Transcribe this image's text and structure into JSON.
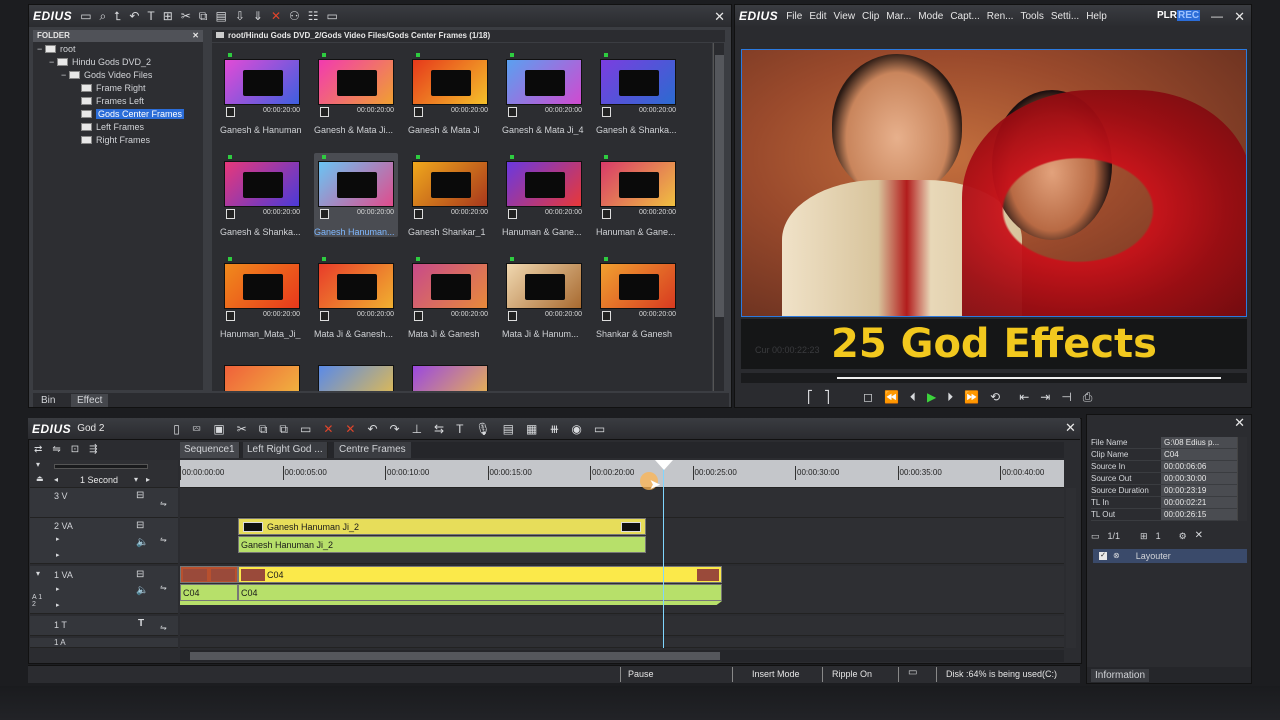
{
  "bin_window": {
    "brand": "EDIUS",
    "folder_header": "FOLDER",
    "path": "root/Hindu Gods DVD_2/Gods Video Files/Gods Center Frames (1/18)",
    "tree": [
      {
        "label": "root",
        "indent": 0
      },
      {
        "label": "Hindu Gods DVD_2",
        "indent": 1
      },
      {
        "label": "Gods Video Files",
        "indent": 2
      },
      {
        "label": "Frame Right",
        "indent": 3
      },
      {
        "label": "Frames Left",
        "indent": 3
      },
      {
        "label": "Gods Center Frames",
        "indent": 3,
        "selected": true
      },
      {
        "label": "Left Frames",
        "indent": 3
      },
      {
        "label": "Right Frames",
        "indent": 3
      }
    ],
    "thumbs": [
      {
        "name": "Ganesh & Hanuman",
        "dur": "00:00:20:00",
        "c1": "#e24bd6",
        "c2": "#3d5fe0"
      },
      {
        "name": "Ganesh & Mata Ji...",
        "dur": "00:00:20:00",
        "c1": "#f23ab0",
        "c2": "#f0a030"
      },
      {
        "name": "Ganesh & Mata Ji",
        "dur": "00:00:20:00",
        "c1": "#e6391b",
        "c2": "#f5c02a"
      },
      {
        "name": "Ganesh & Mata Ji_4",
        "dur": "00:00:20:00",
        "c1": "#5aa0f0",
        "c2": "#d04ad0"
      },
      {
        "name": "Ganesh & Shanka...",
        "dur": "00:00:20:00",
        "c1": "#7b3de0",
        "c2": "#2b6bd0"
      },
      {
        "name": "Ganesh & Shanka...",
        "dur": "00:00:20:00",
        "c1": "#e8387a",
        "c2": "#4a3ad8"
      },
      {
        "name": "Ganesh Hanuman...",
        "dur": "00:00:20:00",
        "c1": "#6ac4f4",
        "c2": "#e04c8c",
        "selected": true
      },
      {
        "name": "Ganesh Shankar_1",
        "dur": "00:00:20:00",
        "c1": "#f0a81c",
        "c2": "#a8381c"
      },
      {
        "name": "Hanuman & Gane...",
        "dur": "00:00:20:00",
        "c1": "#6a38e0",
        "c2": "#e83838"
      },
      {
        "name": "Hanuman & Gane...",
        "dur": "00:00:20:00",
        "c1": "#d83a6a",
        "c2": "#f0c040"
      },
      {
        "name": "Hanuman_Mata_Ji_",
        "dur": "00:00:20:00",
        "c1": "#f08a1c",
        "c2": "#e8381c"
      },
      {
        "name": "Mata Ji & Ganesh...",
        "dur": "00:00:20:00",
        "c1": "#e83c2a",
        "c2": "#f0b030"
      },
      {
        "name": "Mata Ji & Ganesh",
        "dur": "00:00:20:00",
        "c1": "#c84a8a",
        "c2": "#e88a3a"
      },
      {
        "name": "Mata Ji & Hanum...",
        "dur": "00:00:20:00",
        "c1": "#f0d8b0",
        "c2": "#a86a30"
      },
      {
        "name": "Shankar & Ganesh",
        "dur": "00:00:20:00",
        "c1": "#f0a030",
        "c2": "#d83a20"
      }
    ],
    "tabs": [
      "Bin",
      "Effect"
    ]
  },
  "player": {
    "brand": "EDIUS",
    "menu": [
      "File",
      "Edit",
      "View",
      "Clip",
      "Mar...",
      "Mode",
      "Capt...",
      "Ren...",
      "Tools",
      "Setti...",
      "Help"
    ],
    "mode_plr": "PLR",
    "mode_rec": "REC",
    "overlay_text": "25 God Effects",
    "overlay_color": "#f2c81e",
    "ghost_tc": "Cur 00:00:22:23"
  },
  "timeline": {
    "brand": "EDIUS",
    "project": "God 2",
    "seq_tabs": [
      "Sequence1",
      "Left Right God ...",
      "Centre Frames"
    ],
    "scale": "1 Second",
    "ruler": [
      "00:00:00:00",
      "00:00:05:00",
      "00:00:10:00",
      "00:00:15:00",
      "00:00:20:00",
      "00:00:25:00",
      "00:00:30:00",
      "00:00:35:00",
      "00:00:40:00"
    ],
    "tracks": {
      "t3v": "3 V",
      "t2va": "2 VA",
      "t1va": "1 VA",
      "t1t": "1 T",
      "t1a": "1 A",
      "a12": "A 1 2"
    },
    "clips": {
      "v2_video": "Ganesh Hanuman Ji_2",
      "v2_audio": "Ganesh Hanuman Ji_2",
      "v1_video": "C04",
      "v1_audio_a": "C04",
      "v1_audio_b": "C04"
    }
  },
  "info": {
    "rows": [
      {
        "k": "File Name",
        "v": "G:\\08 Edius p..."
      },
      {
        "k": "Clip Name",
        "v": "C04"
      },
      {
        "k": "Source In",
        "v": "00:00:06:06"
      },
      {
        "k": "Source Out",
        "v": "00:00:30:00"
      },
      {
        "k": "Source Duration",
        "v": "00:00:23:19"
      },
      {
        "k": "TL In",
        "v": "00:00:02:21"
      },
      {
        "k": "TL Out",
        "v": "00:00:26:15"
      }
    ],
    "counter": "1/1",
    "counter2": "1",
    "layer": "Layouter",
    "tab": "Information"
  },
  "status": {
    "state": "Pause",
    "mode": "Insert Mode",
    "ripple": "Ripple On",
    "disk": "Disk :64% is being used(C:)"
  }
}
